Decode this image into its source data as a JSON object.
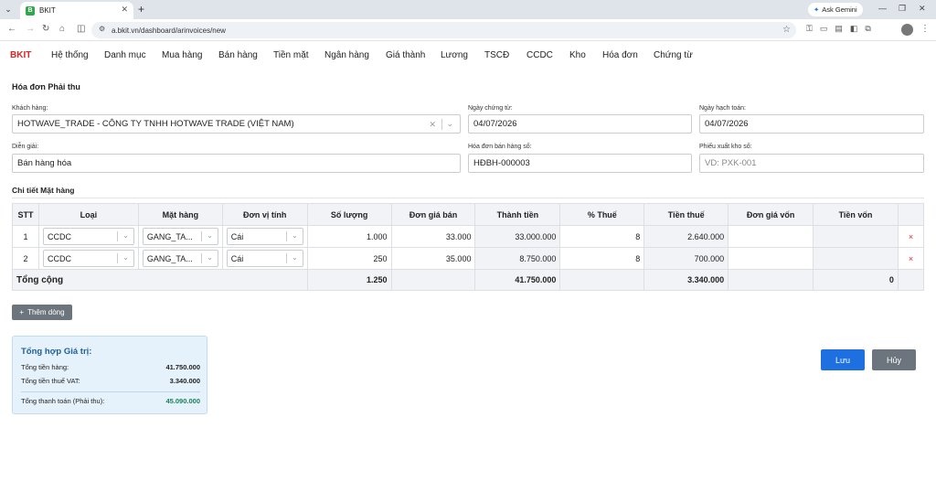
{
  "browser": {
    "tab_title": "BKIT",
    "tab_favicon": "B",
    "gemini_label": "Ask Gemini",
    "url": "a.bkit.vn/dashboard/arinvoices/new"
  },
  "nav": {
    "brand": "BKIT",
    "items": [
      "Hệ thống",
      "Danh mục",
      "Mua hàng",
      "Bán hàng",
      "Tiền mặt",
      "Ngân hàng",
      "Giá thành",
      "Lương",
      "TSCĐ",
      "CCDC",
      "Kho",
      "Hóa đơn",
      "Chứng từ"
    ]
  },
  "page": {
    "title": "Hóa đơn Phải thu"
  },
  "form": {
    "customer_label": "Khách hàng:",
    "customer_value": "HOTWAVE_TRADE - CÔNG TY TNHH HOTWAVE TRADE (VIỆT NAM)",
    "doc_date_label": "Ngày chứng từ:",
    "doc_date_value": "04/07/2026",
    "post_date_label": "Ngày hạch toán:",
    "post_date_value": "04/07/2026",
    "desc_label": "Diễn giải:",
    "desc_value": "Bán hàng hóa",
    "invoice_no_label": "Hóa đơn bán hàng số:",
    "invoice_no_value": "HĐBH-000003",
    "stock_out_label": "Phiếu xuất kho số:",
    "stock_out_placeholder": "VD: PXK-001"
  },
  "details": {
    "section_title": "Chi tiết Mặt hàng",
    "columns": [
      "STT",
      "Loại",
      "Mặt hàng",
      "Đơn vị tính",
      "Số lượng",
      "Đơn giá bán",
      "Thành tiền",
      "% Thuế",
      "Tiền thuế",
      "Đơn giá vốn",
      "Tiền vốn",
      ""
    ],
    "rows": [
      {
        "stt": "1",
        "type": "CCDC",
        "item": "GANG_TA...",
        "unit": "Cái",
        "qty": "1.000",
        "price": "33.000",
        "amount": "33.000.000",
        "tax_pct": "8",
        "tax": "2.640.000",
        "cost_price": "",
        "cost": ""
      },
      {
        "stt": "2",
        "type": "CCDC",
        "item": "GANG_TA...",
        "unit": "Cái",
        "qty": "250",
        "price": "35.000",
        "amount": "8.750.000",
        "tax_pct": "8",
        "tax": "700.000",
        "cost_price": "",
        "cost": ""
      }
    ],
    "total": {
      "label": "Tổng cộng",
      "qty": "1.250",
      "amount": "41.750.000",
      "tax": "3.340.000",
      "cost": "0"
    },
    "add_row_label": "Thêm dòng",
    "delete_glyph": "×"
  },
  "summary": {
    "title": "Tổng hợp Giá trị:",
    "goods_label": "Tổng tiền hàng:",
    "goods_value": "41.750.000",
    "vat_label": "Tổng tiền thuế VAT:",
    "vat_value": "3.340.000",
    "total_label": "Tổng thanh toán (Phải thu):",
    "total_value": "45.090.000"
  },
  "actions": {
    "save_label": "Lưu",
    "cancel_label": "Hủy"
  },
  "colors": {
    "brand": "#e02424",
    "primary": "#1e6fe0",
    "secondary": "#6c757d",
    "summary_total": "#1a7f5a"
  }
}
